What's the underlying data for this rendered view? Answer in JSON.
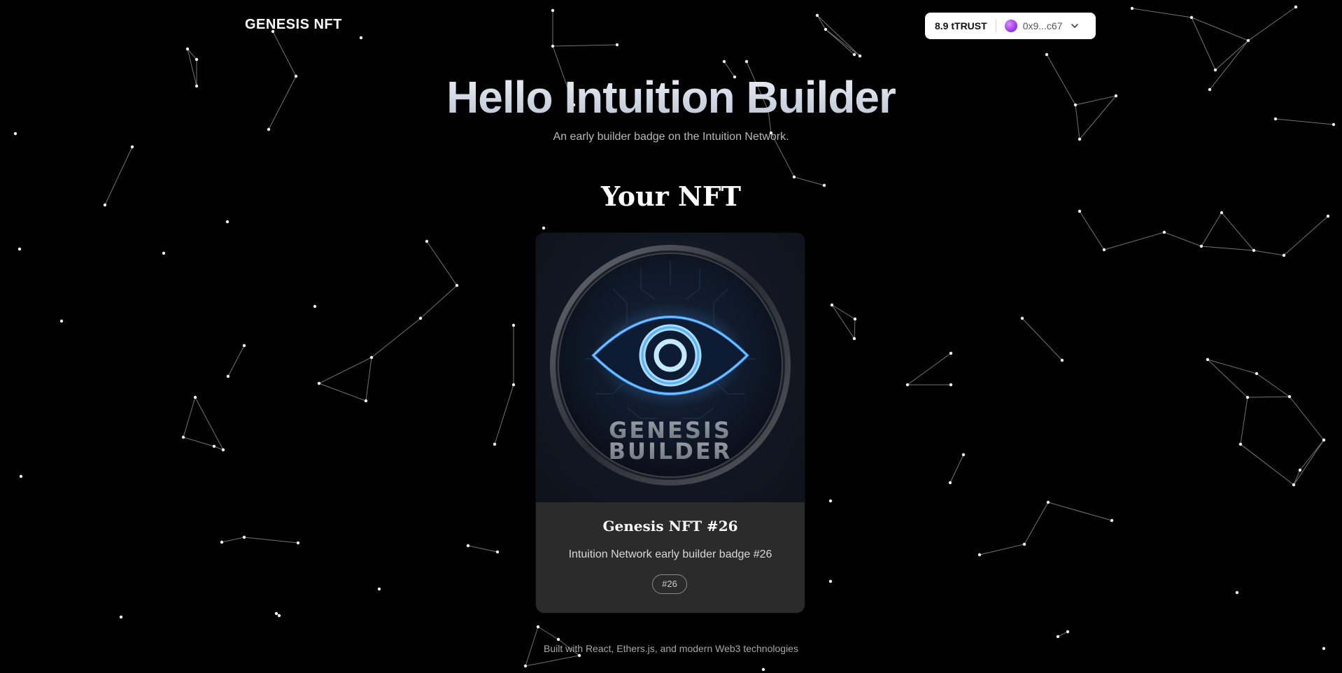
{
  "header": {
    "brand": "GENESIS NFT",
    "wallet": {
      "balance": "8.9 tTRUST",
      "address": "0x9...c67",
      "avatar_color": "#a94bea"
    }
  },
  "hero": {
    "title": "Hello Intuition Builder",
    "subtitle": "An early builder badge on the Intuition Network."
  },
  "section": {
    "title": "Your NFT"
  },
  "nft": {
    "art_text_line1": "GENESIS",
    "art_text_line2": "BUILDER",
    "name": "Genesis NFT #26",
    "description": "Intuition Network early builder badge #26",
    "badge": "#26",
    "accent_color": "#3a9bff"
  },
  "footer": {
    "text": "Built with React, Ethers.js, and modern Web3 technologies"
  }
}
